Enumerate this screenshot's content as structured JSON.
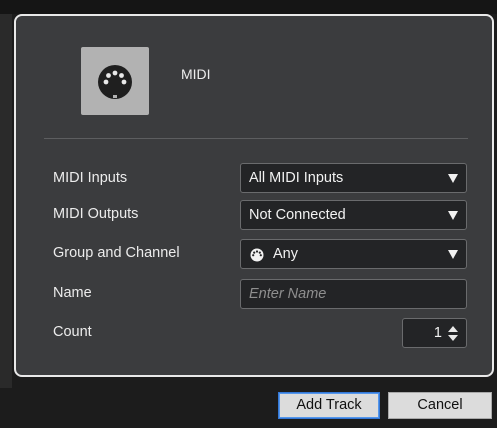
{
  "track_type": {
    "label": "MIDI",
    "icon": "midi-connector-icon"
  },
  "fields": {
    "midi_inputs": {
      "label": "MIDI Inputs",
      "value": "All MIDI Inputs"
    },
    "midi_outputs": {
      "label": "MIDI Outputs",
      "value": "Not Connected"
    },
    "group_channel": {
      "label": "Group and Channel",
      "value": "Any"
    },
    "name": {
      "label": "Name",
      "placeholder": "Enter Name",
      "value": ""
    },
    "count": {
      "label": "Count",
      "value": "1"
    }
  },
  "buttons": {
    "add_track": "Add Track",
    "cancel": "Cancel"
  },
  "colors": {
    "panel_bg": "#3b3c3e",
    "field_bg": "#232426",
    "accent_focus": "#3478d6"
  }
}
